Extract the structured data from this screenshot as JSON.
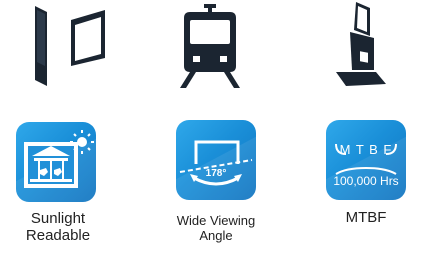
{
  "icons": {
    "display_icon": "kiosk-standing-display-and-wall-panel-icon",
    "train_icon": "train-front-icon",
    "kiosk_icon": "self-service-kiosk-icon",
    "sunlight_icon": "sunlit-carousel-screen-icon",
    "viewing_icon": "viewing-angle-icon",
    "mtbf_icon": "mtbf-badge-icon"
  },
  "colors": {
    "icon_dark": "#1b2531",
    "tile_blue": "#1a8fd8"
  },
  "features": [
    {
      "title_line1": "Sunlight",
      "title_line2": "Readable"
    },
    {
      "title_line1": "Wide Viewing",
      "title_line2": "Angle",
      "angle": "178°"
    },
    {
      "title": "MTBF",
      "badge": "M T B F",
      "value": "100,000 Hrs"
    }
  ]
}
